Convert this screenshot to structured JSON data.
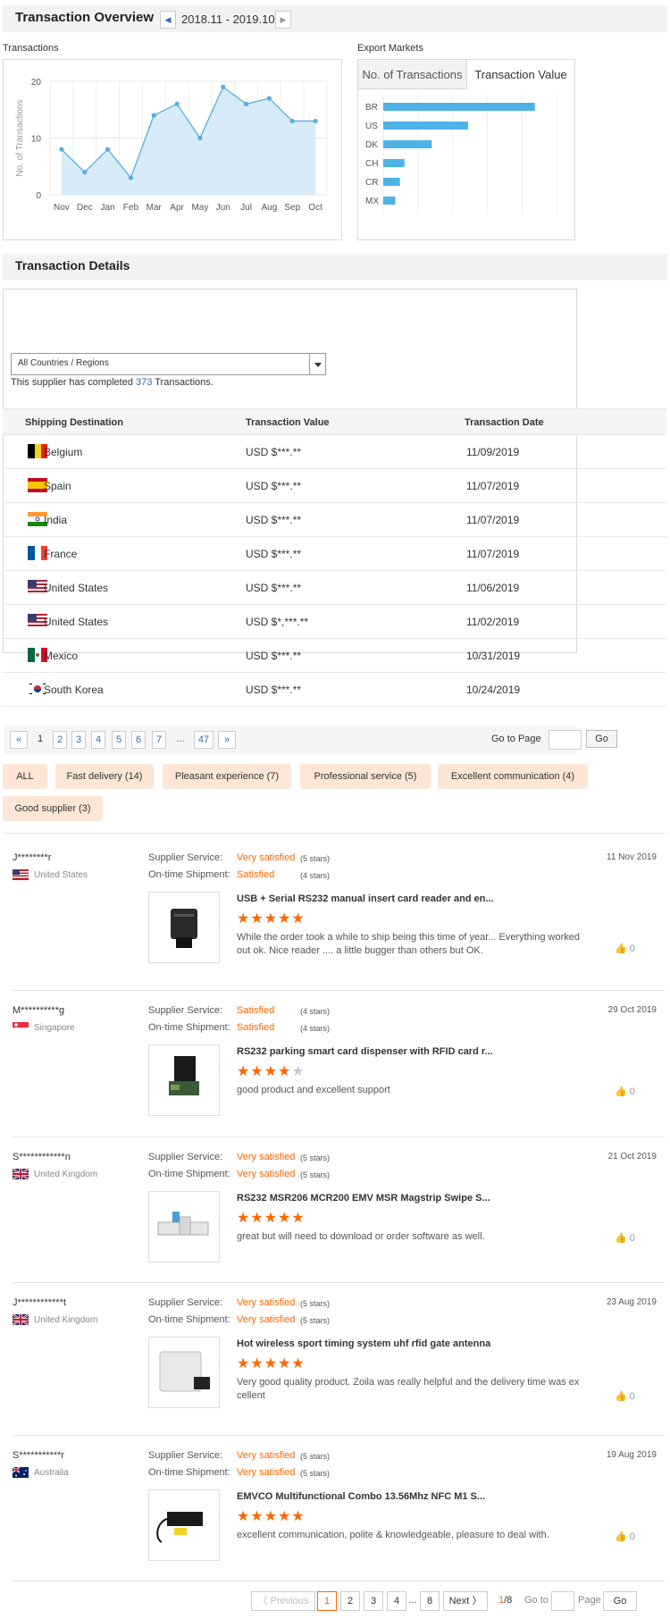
{
  "overview": {
    "title": "Transaction Overview",
    "date_range": "2018.11 - 2019.10",
    "prev_icon": "◀",
    "next_icon": "▶"
  },
  "transactions_label": "Transactions",
  "chart_data": [
    {
      "type": "area",
      "title": "",
      "xlabel": "",
      "ylabel": "No. of Transactions",
      "categories": [
        "Nov",
        "Dec",
        "Jan",
        "Feb",
        "Mar",
        "Apr",
        "May",
        "Jun",
        "Jul",
        "Aug",
        "Sep",
        "Oct"
      ],
      "values": [
        8,
        4,
        8,
        3,
        14,
        16,
        10,
        19,
        16,
        17,
        13,
        13
      ],
      "ylim": [
        0,
        20
      ],
      "yticks": [
        "0",
        "10",
        "20"
      ],
      "grid": true,
      "color": "#5aaedf",
      "fill": "#d7ebf8"
    },
    {
      "type": "bar",
      "orientation": "horizontal",
      "categories": [
        "BR",
        "US",
        "DK",
        "CH",
        "CR",
        "MX"
      ],
      "values": [
        100,
        56,
        32,
        14,
        11,
        8
      ],
      "color": "#4db3e6",
      "grid": true
    }
  ],
  "export": {
    "label": "Export Markets",
    "tab1": "No. of Transactions",
    "tab2": "Transaction Value"
  },
  "details": {
    "title": "Transaction Details",
    "filter": "All Countries / Regions",
    "summary_pre": "This supplier has completed ",
    "count": "373",
    "summary_post": " Transactions.",
    "headers": [
      "Shipping Destination",
      "Transaction Value",
      "Transaction Date"
    ],
    "rows": [
      {
        "country": "Belgium",
        "value": "USD $***.**",
        "date": "11/09/2019",
        "flag": "belgium-flag"
      },
      {
        "country": "Spain",
        "value": "USD $***.**",
        "date": "11/07/2019",
        "flag": "spain-flag"
      },
      {
        "country": "India",
        "value": "USD $***.**",
        "date": "11/07/2019",
        "flag": "india-flag"
      },
      {
        "country": "France",
        "value": "USD $***.**",
        "date": "11/07/2019",
        "flag": "france-flag"
      },
      {
        "country": "United States",
        "value": "USD $***.**",
        "date": "11/06/2019",
        "flag": "us-flag"
      },
      {
        "country": "United States",
        "value": "USD $*,***.**",
        "date": "11/02/2019",
        "flag": "us-flag"
      },
      {
        "country": "Mexico",
        "value": "USD $***.**",
        "date": "10/31/2019",
        "flag": "mexico-flag"
      },
      {
        "country": "South Korea",
        "value": "USD $***.**",
        "date": "10/24/2019",
        "flag": "korea-flag"
      }
    ],
    "pager": {
      "first": "«",
      "pages": [
        "1",
        "2",
        "3",
        "4",
        "5",
        "6",
        "7"
      ],
      "ellipsis": "...",
      "last_page": "47",
      "last": "»",
      "goto_label": "Go to Page",
      "go": "Go"
    }
  },
  "tags": [
    "ALL",
    "Fast delivery (14)",
    "Pleasant experience (7)",
    "Professional service (5)",
    "Excellent communication (4)",
    "Good supplier (3)"
  ],
  "review_labels": {
    "service": "Supplier Service:",
    "shipment": "On-time Shipment:"
  },
  "reviews": [
    {
      "name": "J********r",
      "country": "United States",
      "flag": "us-flag",
      "service": "Very satisfied",
      "service_stars": "(5 stars)",
      "ship": "Satisfied",
      "ship_stars": "(4 stars)",
      "date": "11 Nov 2019",
      "product": "USB + Serial RS232 manual insert card reader and en...",
      "rating": 5,
      "text": "While the order took a while to ship being this time of year... Everything worked out ok.  Nice reader .... a little bugger than others but OK.",
      "likes": "0"
    },
    {
      "name": "M**********g",
      "country": "Singapore",
      "flag": "singapore-flag",
      "service": "Satisfied",
      "service_stars": "(4 stars)",
      "ship": "Satisfied",
      "ship_stars": "(4 stars)",
      "date": "29 Oct 2019",
      "product": "RS232 parking smart card dispenser with RFID card r...",
      "rating": 4,
      "text": "good product and excellent support",
      "likes": "0"
    },
    {
      "name": "S************n",
      "country": "United Kingdom",
      "flag": "uk-flag",
      "service": "Very satisfied",
      "service_stars": "(5 stars)",
      "ship": "Very satisfied",
      "ship_stars": "(5 stars)",
      "date": "21 Oct 2019",
      "product": "RS232 MSR206 MCR200 EMV MSR Magstrip Swipe S...",
      "rating": 5,
      "text": "great but will need to download or order software as well.",
      "likes": "0"
    },
    {
      "name": "J************t",
      "country": "United Kingdom",
      "flag": "uk-flag",
      "service": "Very satisfied",
      "service_stars": "(5 stars)",
      "ship": "Very satisfied",
      "ship_stars": "(5 stars)",
      "date": "23 Aug 2019",
      "product": "Hot wireless sport timing system uhf rfid gate antenna",
      "rating": 5,
      "text": "Very good quality product. Zoila was really helpful and the delivery time was ex cellent",
      "likes": "0"
    },
    {
      "name": "S***********r",
      "country": "Australia",
      "flag": "australia-flag",
      "service": "Very satisfied",
      "service_stars": "(5 stars)",
      "ship": "Very satisfied",
      "ship_stars": "(5 stars)",
      "date": "19 Aug 2019",
      "product": "EMVCO Multifunctional Combo 13.56Mhz NFC M1 S...",
      "rating": 5,
      "text": "excellent communication, polite & knowledgeable, pleasure to deal with.",
      "likes": "0"
    }
  ],
  "review_pager": {
    "prev": "〈 Previous",
    "pages": [
      "1",
      "2",
      "3",
      "4"
    ],
    "ellipsis": "...",
    "last": "8",
    "next": "Next 〉",
    "current": "1",
    "total": "/8",
    "goto": "Go to",
    "page": "Page",
    "go": "Go"
  }
}
